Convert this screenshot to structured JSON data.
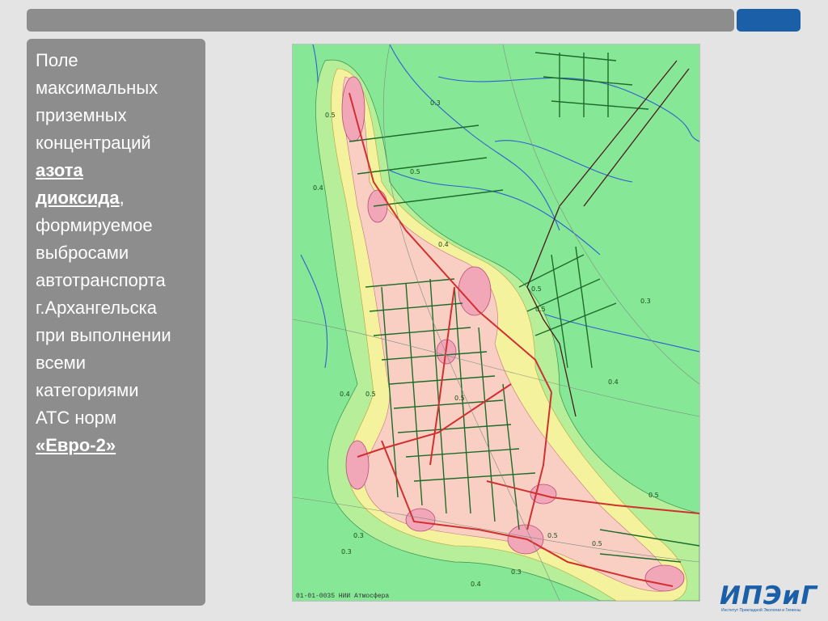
{
  "caption": {
    "line1": "Поле",
    "line2": "максимальных",
    "line3": "приземных",
    "line4": "концентраций",
    "bold1": "азота",
    "bold2": "диоксида",
    "comma": ",",
    "line5": "формируемое",
    "line6": "выбросами",
    "line7": "автотранспорта",
    "line8": "г.Архангельска",
    "line9": "при выполнении",
    "line10": "всеми",
    "line11": "категориями",
    "line12": "АТС норм",
    "bold3": "«Евро-2»"
  },
  "map": {
    "footer": "01-01-0035 НИИ Атмосфера",
    "isoline_labels": [
      "0.5",
      "0.4",
      "0.3",
      "0.5",
      "0.4",
      "0.5",
      "0.5",
      "0.4",
      "0.5",
      "0.3",
      "0.4",
      "0.3",
      "0.3",
      "0.5",
      "0.5",
      "0.5",
      "0.5",
      "0.4",
      "0.3"
    ],
    "colors": {
      "background": "#86e896",
      "low": "#b6ee9a",
      "mid": "#f4f29c",
      "high": "#f8cfc2",
      "peak": "#f2a7b8",
      "road": "#d13030",
      "street": "#1d6b2b",
      "water": "#2f5fd0"
    }
  },
  "logo": {
    "text": "ИПЭиГ",
    "subtitle": "Институт Прикладной Экологии и Гигиены"
  }
}
